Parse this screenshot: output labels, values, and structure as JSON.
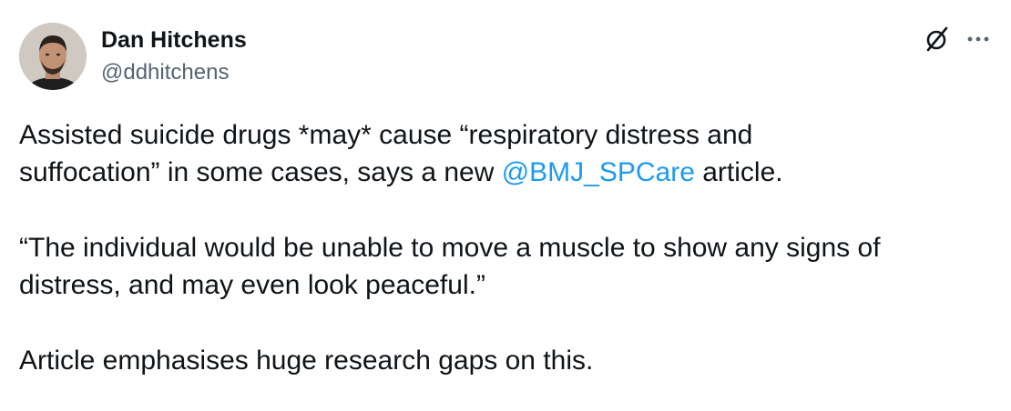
{
  "author": {
    "display_name": "Dan Hitchens",
    "handle": "@ddhitchens"
  },
  "icons": {
    "grok": "grok-icon",
    "more": "more-icon",
    "avatar": "avatar-photo"
  },
  "colors": {
    "text": "#0f1419",
    "secondary": "#536471",
    "link": "#1d9bf0"
  },
  "tweet": {
    "p1_line1": "Assisted suicide drugs *may* cause “respiratory distress and",
    "p1_line2_start": "suffocation” in some cases, says a new ",
    "p1_mention": "@BMJ_SPCare",
    "p1_line2_end": " article.",
    "p2_line1": "“The individual would be unable to move a muscle to show any signs of",
    "p2_line2": "distress, and may even look peaceful.”",
    "p3": "Article emphasises huge research gaps on this."
  }
}
